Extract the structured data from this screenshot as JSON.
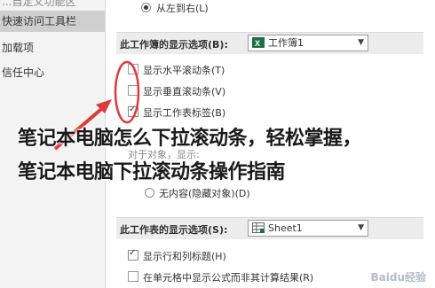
{
  "sidebar": {
    "items": [
      {
        "label": "...自定义功能区"
      },
      {
        "label": "快速访问工具栏"
      },
      {
        "label": "加载项"
      },
      {
        "label": "信任中心"
      }
    ]
  },
  "direction": {
    "rtl_label": "从左到右(L)"
  },
  "workbook_section": {
    "title": "此工作簿的显示选项(B):",
    "selected": "工作簿1",
    "options": [
      {
        "label": "显示水平滚动条(T)",
        "checked": false
      },
      {
        "label": "显示垂直滚动条(V)",
        "checked": false
      },
      {
        "label": "显示工作表标签(B)",
        "checked": true
      }
    ],
    "objects_label": "对于对象，显示:",
    "objects_choice": "无内容(隐藏对象)(D)"
  },
  "sheet_section": {
    "title": "此工作表的显示选项(S):",
    "selected": "Sheet1",
    "options": [
      {
        "label": "显示行和列标题(H)",
        "checked": true
      },
      {
        "label": "在单元格中显示公式而非其计算结果(R)",
        "checked": false
      }
    ]
  },
  "overlay": {
    "line1": "笔记本电脑怎么下拉滚动条，轻松掌握，",
    "line2": "笔记本电脑下拉滚动条操作指南"
  },
  "watermark": "Baidu经验",
  "colors": {
    "annotation": "#e0393a",
    "excel_green": "#1d7044"
  }
}
